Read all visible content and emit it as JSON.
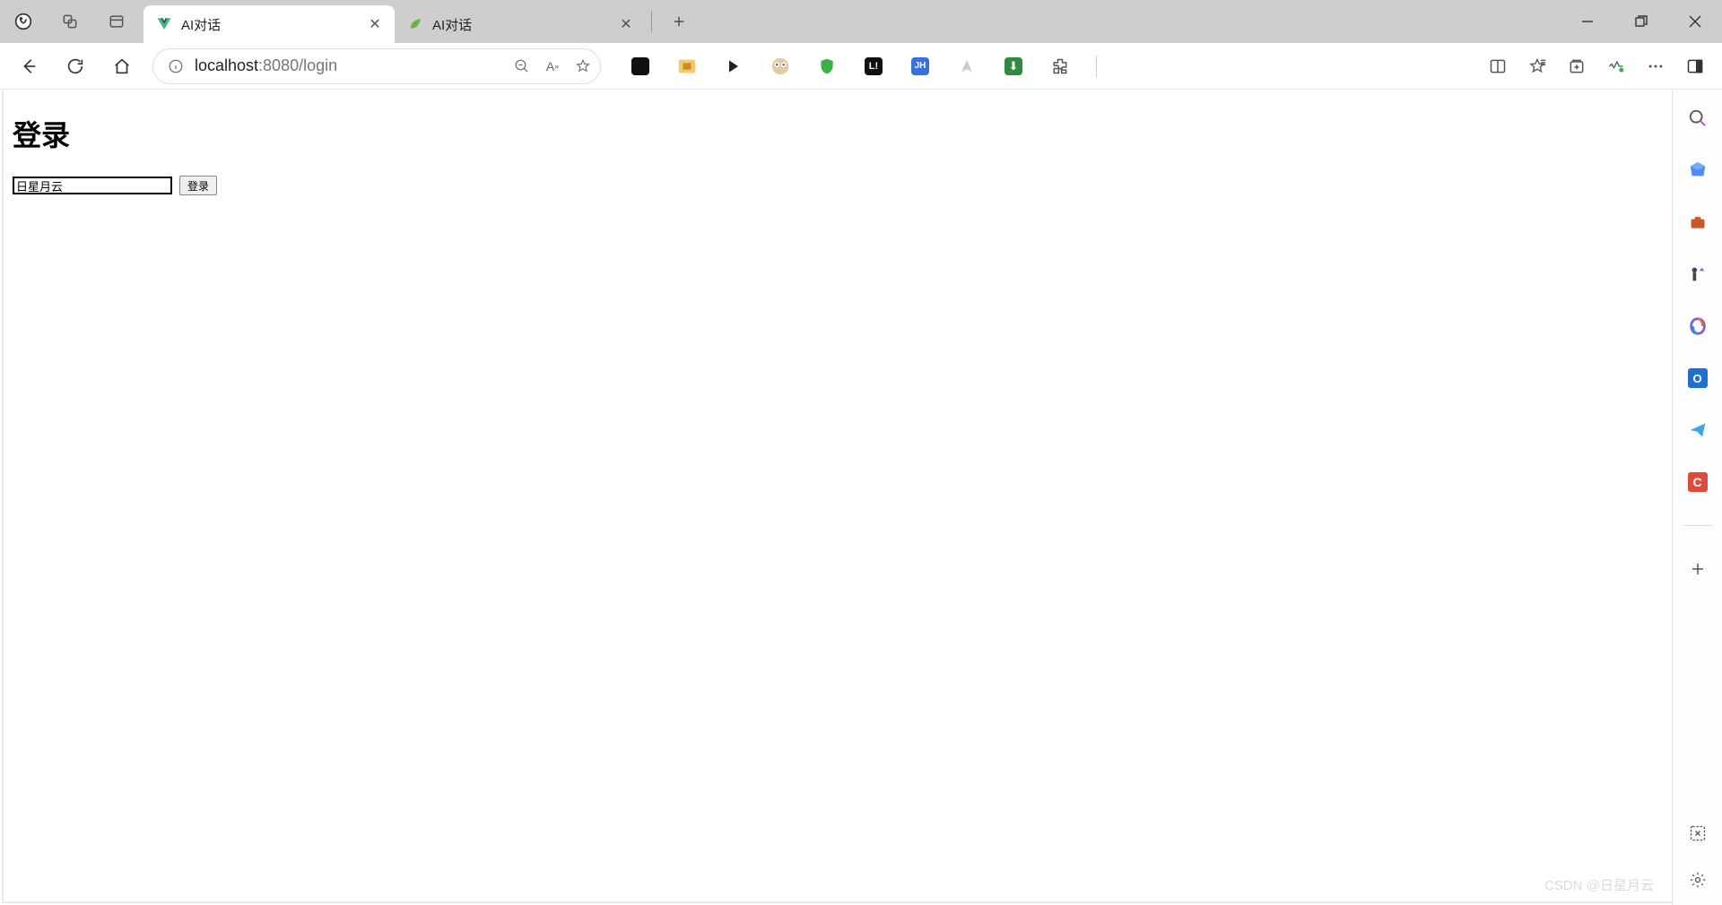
{
  "tabs": [
    {
      "label": "AI对话",
      "favicon": "vue",
      "active": true
    },
    {
      "label": "AI对话",
      "favicon": "leaf",
      "active": false
    }
  ],
  "address": {
    "host": "localhost",
    "port": ":8080",
    "path": "/login"
  },
  "page": {
    "title": "登录",
    "username_value": "日星月云",
    "login_button": "登录"
  },
  "watermark": "CSDN @日星月云"
}
